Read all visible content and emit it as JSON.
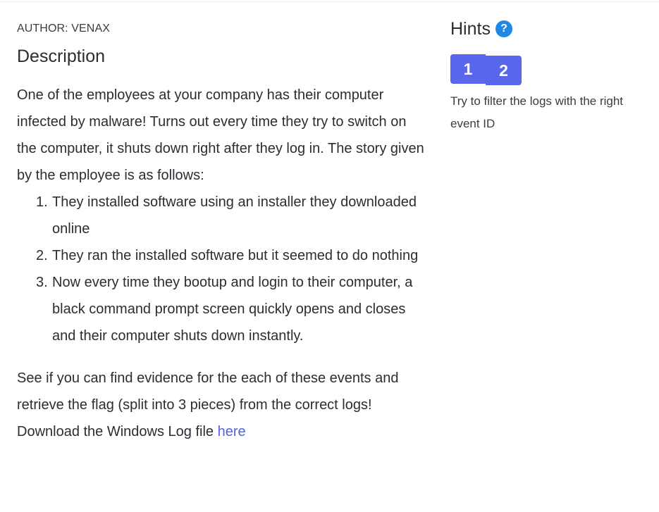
{
  "author": "AUTHOR: VENAX",
  "description": {
    "title": "Description",
    "intro": "One of the employees at your company has their computer infected by malware! Turns out every time they try to switch on the computer, it shuts down right after they log in. The story given by the employee is as follows:",
    "steps": [
      {
        "num": "1.",
        "text": "They installed software using an installer they downloaded online"
      },
      {
        "num": "2.",
        "text": "They ran the installed software but it seemed to do nothing"
      },
      {
        "num": "3.",
        "text": "Now every time they bootup and login to their computer, a black command prompt screen quickly opens and closes and their computer shuts down instantly."
      }
    ],
    "outro": "See if you can find evidence for the each of these events and retrieve the flag (split into 3 pieces) from the correct logs!",
    "download_prefix": "Download the Windows Log file ",
    "download_link": "here"
  },
  "hints": {
    "title": "Hints",
    "help_symbol": "?",
    "tabs": [
      "1",
      "2"
    ],
    "text": "Try to filter the logs with the right event ID"
  },
  "colors": {
    "accent": "#5a67ec",
    "help_icon": "#1e88e5",
    "link": "#5562e6",
    "text": "#2b2d33"
  }
}
